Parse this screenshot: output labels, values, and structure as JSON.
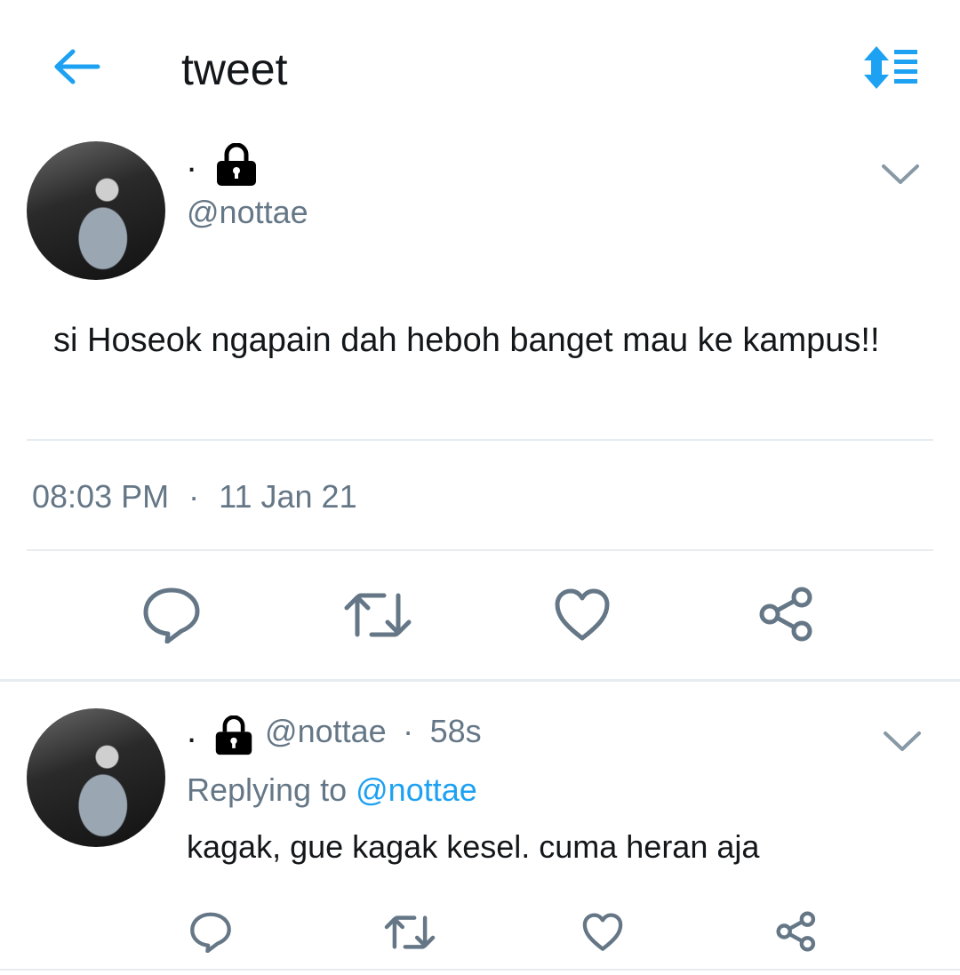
{
  "header": {
    "title": "tweet",
    "back_icon": "arrow-left-icon",
    "sort_icon": "sort-list-icon"
  },
  "colors": {
    "accent": "#1da1f2",
    "muted": "#657786",
    "text": "#14171a",
    "divider": "#e6ecf0"
  },
  "main_tweet": {
    "display_name": ".",
    "handle": "@nottae",
    "text": "si Hoseok ngapain dah heboh banget mau ke kampus!!",
    "time": "08:03 PM",
    "separator": "·",
    "date": "11 Jan 21"
  },
  "reply_tweet": {
    "display_name": ".",
    "handle": "@nottae",
    "separator": "·",
    "age": "58s",
    "replying_prefix": "Replying to",
    "replying_handle": "@nottae",
    "text": "kagak, gue kagak kesel. cuma heran aja"
  }
}
